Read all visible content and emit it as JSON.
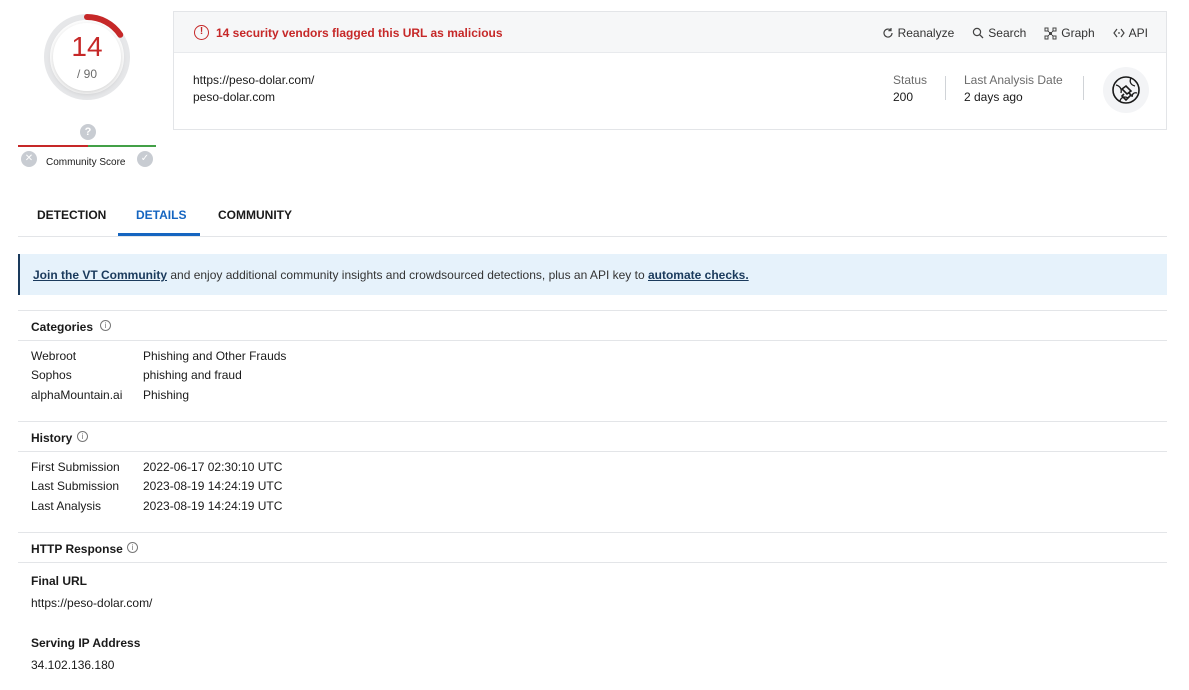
{
  "score": {
    "detections": "14",
    "total": "/ 90",
    "detections_fraction": 0.156,
    "color": "#c62828"
  },
  "community": {
    "label": "Community Score",
    "question": "?",
    "down_icon": "x-icon",
    "up_icon": "check-icon"
  },
  "alert": {
    "text": "14 security vendors flagged this URL as malicious",
    "icon": "exclamation-circle-icon"
  },
  "actions": [
    {
      "label": "Reanalyze",
      "icon": "refresh-icon"
    },
    {
      "label": "Search",
      "icon": "search-icon"
    },
    {
      "label": "Graph",
      "icon": "graph-icon"
    },
    {
      "label": "API",
      "icon": "api-icon"
    }
  ],
  "target": {
    "url": "https://peso-dolar.com/",
    "domain": "peso-dolar.com"
  },
  "status": {
    "label": "Status",
    "value": "200"
  },
  "last_analysis": {
    "label": "Last Analysis Date",
    "value": "2 days ago"
  },
  "tabs": [
    "DETECTION",
    "DETAILS",
    "COMMUNITY"
  ],
  "active_tab": "DETAILS",
  "banner": {
    "link1": "Join the VT Community",
    "middle": " and enjoy additional community insights and crowdsourced detections, plus an API key to ",
    "link2": "automate checks."
  },
  "categories": {
    "title": "Categories",
    "rows": [
      {
        "k": "Webroot",
        "v": "Phishing and Other Frauds"
      },
      {
        "k": "Sophos",
        "v": "phishing and fraud"
      },
      {
        "k": "alphaMountain.ai",
        "v": "Phishing"
      }
    ]
  },
  "history": {
    "title": "History",
    "rows": [
      {
        "k": "First Submission",
        "v": "2022-06-17 02:30:10 UTC"
      },
      {
        "k": "Last Submission",
        "v": "2023-08-19 14:24:19 UTC"
      },
      {
        "k": "Last Analysis",
        "v": "2023-08-19 14:24:19 UTC"
      }
    ]
  },
  "http": {
    "title": "HTTP Response",
    "final_url_label": "Final URL",
    "final_url": "https://peso-dolar.com/",
    "ip_label": "Serving IP Address",
    "ip": "34.102.136.180"
  }
}
